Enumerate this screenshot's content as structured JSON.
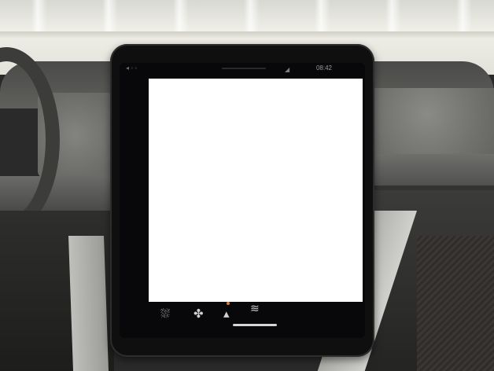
{
  "scene": {
    "description_type": "car-interior-photo",
    "device": "center-console-tablet"
  },
  "status_bar": {
    "time": "08:42",
    "signal": "◢",
    "left_icons": "◂ ◦ ◦"
  },
  "screen": {
    "content_redacted": true,
    "redaction_color": "#ffffff"
  },
  "dock": {
    "icons": [
      {
        "name": "seat-heat-icon",
        "glyph": "⛆"
      },
      {
        "name": "fan-icon",
        "glyph": "✤"
      },
      {
        "name": "temperature-icon",
        "glyph": "▴"
      },
      {
        "name": "defrost-icon",
        "glyph": "≋"
      }
    ]
  },
  "colors": {
    "tablet_bezel": "#0f0f10",
    "screen_bg": "#08080a",
    "dock_icon": "#cfcfd4",
    "accent_orange": "#e07a3a",
    "accent_pink": "#c8457a"
  }
}
